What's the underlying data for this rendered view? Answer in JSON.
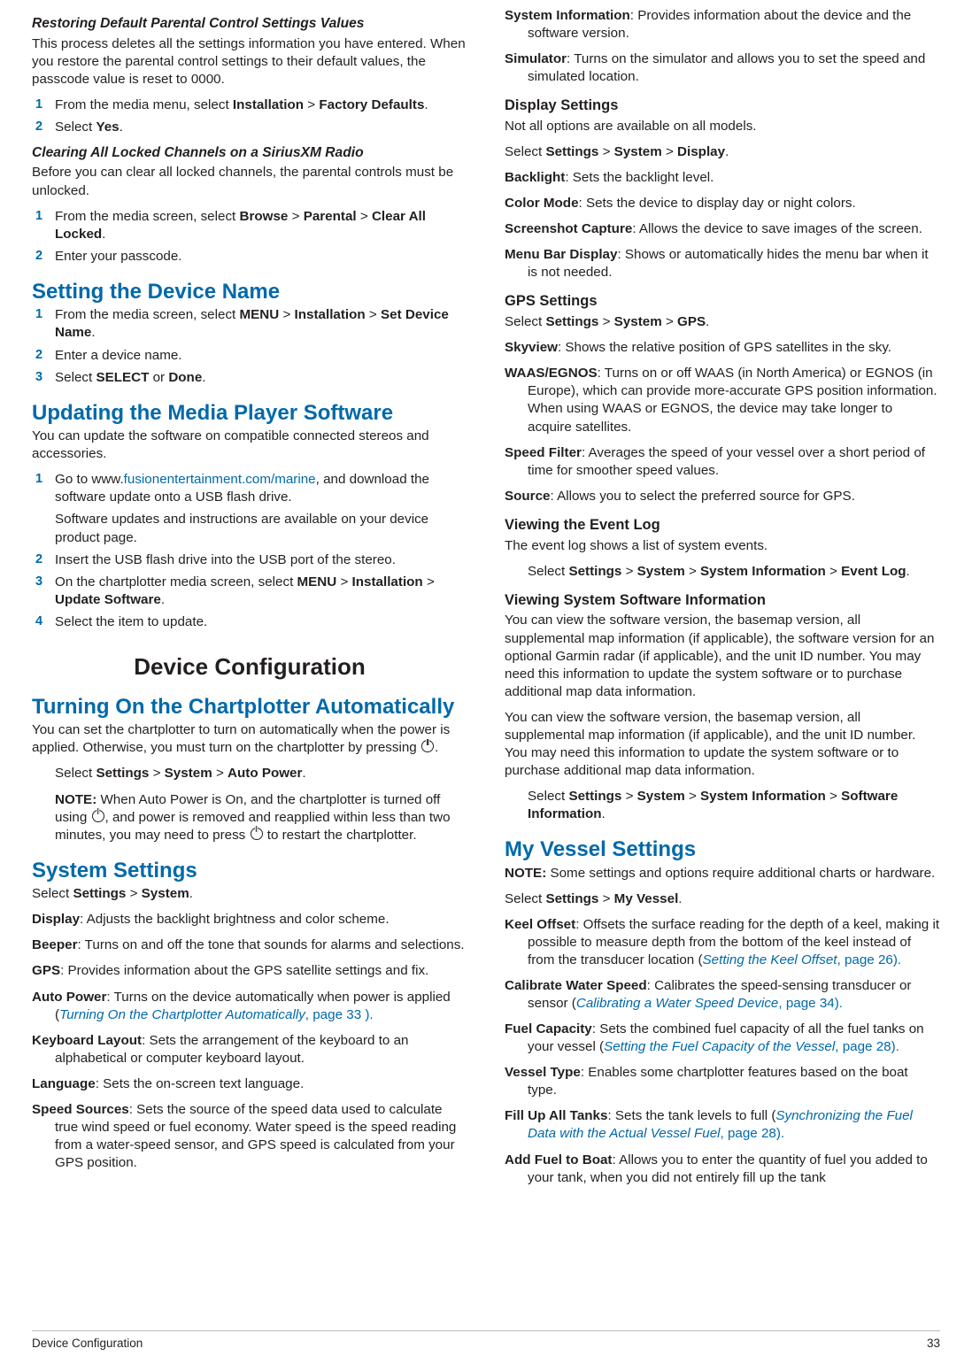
{
  "footer": {
    "left": "Device Configuration",
    "right": "33"
  },
  "left": {
    "s1": {
      "heading": "Restoring Default Parental Control Settings Values",
      "body": "This process deletes all the settings information you have entered. When you restore the parental control settings to their default values, the passcode value is reset to 0000.",
      "step1_a": "From the media menu, select ",
      "step1_b": "Installation",
      "step1_c": " > ",
      "step1_d": "Factory Defaults",
      "step1_e": ".",
      "step2_a": "Select ",
      "step2_b": "Yes",
      "step2_c": "."
    },
    "s2": {
      "heading": "Clearing All Locked Channels on a SiriusXM Radio",
      "body": "Before you can clear all locked channels, the parental controls must be unlocked.",
      "step1_a": "From the media screen, select ",
      "step1_b": "Browse",
      "step1_c": " > ",
      "step1_d": "Parental",
      "step1_e": " > ",
      "step1_f": "Clear All Locked",
      "step1_g": ".",
      "step2": "Enter your passcode."
    },
    "s3": {
      "heading": "Setting the Device Name",
      "step1_a": "From the media screen, select ",
      "step1_b": "MENU",
      "step1_c": " > ",
      "step1_d": "Installation",
      "step1_e": " > ",
      "step1_f": "Set Device Name",
      "step1_g": ".",
      "step2": "Enter a device name.",
      "step3_a": "Select ",
      "step3_b": "SELECT",
      "step3_c": " or ",
      "step3_d": "Done",
      "step3_e": "."
    },
    "s4": {
      "heading": "Updating the Media Player Software",
      "body": "You can update the software on compatible connected stereos and accessories.",
      "step1_a": "Go to ",
      "step1_url_plain": "www.",
      "step1_url_link": "fusionentertainment.com/marine",
      "step1_b": ", and download the software update onto a USB flash drive.",
      "step1_note": "Software updates and instructions are available on your device product page.",
      "step2": "Insert the USB flash drive into the USB port of the stereo.",
      "step3_a": "On the chartplotter media screen, select ",
      "step3_b": "MENU",
      "step3_c": " > ",
      "step3_d": "Installation",
      "step3_e": " > ",
      "step3_f": "Update Software",
      "step3_g": ".",
      "step4": "Select the item to update."
    },
    "chapter_title": "Device Configuration",
    "s5": {
      "heading": "Turning On the Chartplotter Automatically",
      "body_a": "You can set the chartplotter to turn on automatically when the power is applied. Otherwise, you must turn on the chartplotter by pressing ",
      "body_b": ".",
      "select_a": "Select ",
      "select_b": "Settings",
      "select_c": " > ",
      "select_d": "System",
      "select_e": " > ",
      "select_f": "Auto Power",
      "select_g": ".",
      "note_label": "NOTE:",
      "note_a": " When Auto Power is On, and the chartplotter is turned off using ",
      "note_b": ", and power is removed and reapplied within less than two minutes, you may need to press ",
      "note_c": " to restart the chartplotter."
    },
    "s6": {
      "heading": "System Settings",
      "select_a": "Select ",
      "select_b": "Settings",
      "select_c": " > ",
      "select_d": "System",
      "select_e": ".",
      "items": [
        {
          "term": "Display",
          "desc": ": Adjusts the backlight brightness and color scheme."
        },
        {
          "term": "Beeper",
          "desc": ": Turns on and off the tone that sounds for alarms and selections."
        },
        {
          "term": "GPS",
          "desc": ": Provides information about the GPS satellite settings and fix."
        },
        {
          "term": "Auto Power",
          "desc": ": Turns on the device automatically when power is applied (",
          "xref": "Turning On the Chartplotter Automatically",
          "xref_tail": ", page 33 ).",
          "has_xref": true
        },
        {
          "term": "Keyboard Layout",
          "desc": ": Sets the arrangement of the keyboard to an alphabetical or computer keyboard layout."
        },
        {
          "term": "Language",
          "desc": ": Sets the on-screen text language."
        },
        {
          "term": "Speed Sources",
          "desc": ": Sets the source of the speed data used to calculate true wind speed or fuel economy. Water speed is the speed reading from a water-speed sensor, and GPS speed is calculated from your GPS position."
        }
      ]
    }
  },
  "right": {
    "top_items": [
      {
        "term": "System Information",
        "desc": ": Provides information about the device and the software version."
      },
      {
        "term": "Simulator",
        "desc": ": Turns on the simulator and allows you to set the speed and simulated location."
      }
    ],
    "s1": {
      "heading": "Display Settings",
      "body": "Not all options are available on all models.",
      "select_a": "Select ",
      "select_b": "Settings",
      "select_c": " > ",
      "select_d": "System",
      "select_e": " > ",
      "select_f": "Display",
      "select_g": ".",
      "items": [
        {
          "term": "Backlight",
          "desc": ": Sets the backlight level."
        },
        {
          "term": "Color Mode",
          "desc": ": Sets the device to display day or night colors."
        },
        {
          "term": "Screenshot Capture",
          "desc": ": Allows the device to save images of the screen."
        },
        {
          "term": "Menu Bar Display",
          "desc": ": Shows or automatically hides the menu bar when it is not needed."
        }
      ]
    },
    "s2": {
      "heading": "GPS Settings",
      "select_a": "Select ",
      "select_b": "Settings",
      "select_c": " > ",
      "select_d": "System",
      "select_e": " > ",
      "select_f": "GPS",
      "select_g": ".",
      "items": [
        {
          "term": "Skyview",
          "desc": ": Shows the relative position of GPS satellites in the sky."
        },
        {
          "term": "WAAS/EGNOS",
          "desc": ": Turns on or off WAAS (in North America) or EGNOS (in Europe), which can provide more-accurate GPS position information. When using WAAS or EGNOS, the device may take longer to acquire satellites."
        },
        {
          "term": "Speed Filter",
          "desc": ": Averages the speed of your vessel over a short period of time for smoother speed values."
        },
        {
          "term": "Source",
          "desc": ": Allows you to select the preferred source for GPS."
        }
      ]
    },
    "s3": {
      "heading": "Viewing the Event Log",
      "body": "The event log shows a list of system events.",
      "select_a": "Select ",
      "select_b": "Settings",
      "select_c": " > ",
      "select_d": "System",
      "select_e": " > ",
      "select_f": "System Information",
      "select_g": " > ",
      "select_h": "Event Log",
      "select_i": "."
    },
    "s4": {
      "heading": "Viewing System Software Information",
      "para1": "You can view the software version, the basemap version, all supplemental map information (if applicable), the software version for an optional Garmin radar (if applicable), and the unit ID number. You may need this information to update the system software or to purchase additional map data information.",
      "para2": "You can view the software version, the basemap version, all supplemental map information (if applicable), and the unit ID number. You may need this information to update the system software or to purchase additional map data information.",
      "select_a": "Select ",
      "select_b": "Settings",
      "select_c": " > ",
      "select_d": "System",
      "select_e": " > ",
      "select_f": "System Information",
      "select_g": " > ",
      "select_h": "Software Information",
      "select_i": "."
    },
    "s5": {
      "heading": "My Vessel Settings",
      "note_label": "NOTE:",
      "note_text": " Some settings and options require additional charts or hardware.",
      "select_a": "Select ",
      "select_b": "Settings",
      "select_c": " > ",
      "select_d": "My Vessel",
      "select_e": ".",
      "items": [
        {
          "term": "Keel Offset",
          "desc": ": Offsets the surface reading for the depth of a keel, making it possible to measure depth from the bottom of the keel instead of from the transducer location (",
          "xref": "Setting the Keel Offset",
          "xref_tail": ", page 26).",
          "has_xref": true
        },
        {
          "term": "Calibrate Water Speed",
          "desc": ": Calibrates the speed-sensing transducer or sensor (",
          "xref": "Calibrating a Water Speed Device",
          "xref_tail": ", page 34).",
          "has_xref": true
        },
        {
          "term": "Fuel Capacity",
          "desc": ": Sets the combined fuel capacity of all the fuel tanks on your vessel (",
          "xref": "Setting the Fuel Capacity of the Vessel",
          "xref_tail": ", page 28).",
          "has_xref": true
        },
        {
          "term": "Vessel Type",
          "desc": ": Enables some chartplotter features based on the boat type.",
          "has_xref": false
        },
        {
          "term": "Fill Up All Tanks",
          "desc": ": Sets the tank levels to full (",
          "xref": "Synchronizing the Fuel Data with the Actual Vessel Fuel",
          "xref_tail": ", page 28).",
          "has_xref": true
        },
        {
          "term": "Add Fuel to Boat",
          "desc": ": Allows you to enter the quantity of fuel you added to your tank, when you did not entirely fill up the tank",
          "has_xref": false
        }
      ]
    }
  }
}
